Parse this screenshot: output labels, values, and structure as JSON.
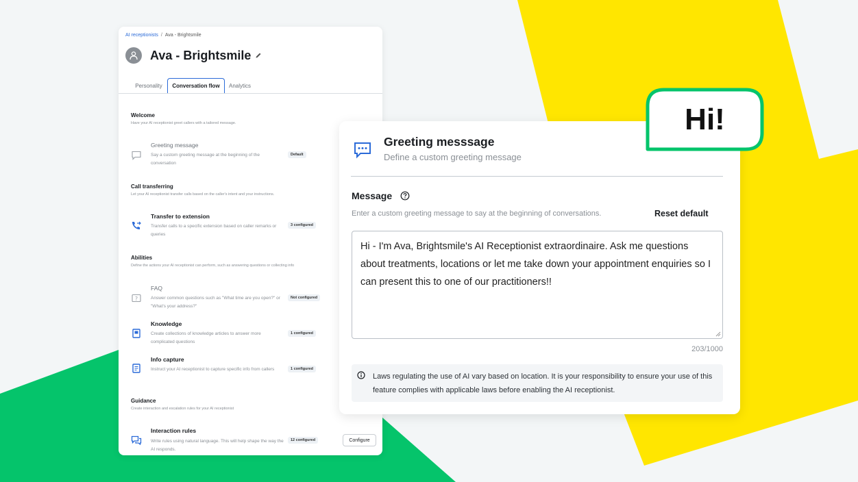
{
  "colors": {
    "background": "#f3f6f7",
    "yellow": "#ffe600",
    "green": "#05c46b",
    "accent_blue": "#2a6ad8"
  },
  "left_panel": {
    "breadcrumb": {
      "root": "AI receptionists",
      "separator": "/",
      "current": "Ava - Brightsmile"
    },
    "title": "Ava - Brightsmile",
    "tabs": [
      {
        "label": "Personality",
        "active": false
      },
      {
        "label": "Conversation flow",
        "active": true
      },
      {
        "label": "Analytics",
        "active": false
      }
    ],
    "sections": [
      {
        "title": "Welcome",
        "description": "Have your AI receptionist greet callers with a tailored message.",
        "items": [
          {
            "icon": "chat-bubble-icon",
            "title": "Greeting message",
            "description": "Say a custom greeting message at the beginning of the conversation",
            "badge": "Default"
          }
        ]
      },
      {
        "title": "Call transferring",
        "description": "Let your AI receptionist transfer calls based on the caller's intent and your instructions.",
        "items": [
          {
            "icon": "phone-forward-icon",
            "title": "Transfer to extension",
            "description": "Transfer calls to a specific extension based on caller remarks or queries",
            "badge": "3 configured"
          }
        ]
      },
      {
        "title": "Abilities",
        "description": "Define the actions your AI receptionist can perform, such as answering questions or collecting info",
        "items": [
          {
            "icon": "faq-icon",
            "title": "FAQ",
            "description": "Answer common questions such as \"What time are you open?\" or \"What's your address?\"",
            "badge": "Not configured"
          },
          {
            "icon": "book-icon",
            "title": "Knowledge",
            "description": "Create collections of knowledge articles to answer more complicated questions",
            "badge": "1 configured"
          },
          {
            "icon": "form-icon",
            "title": "Info capture",
            "description": "Instruct your AI receptionist to capture specific info from callers",
            "badge": "1 configured"
          }
        ]
      },
      {
        "title": "Guidance",
        "description": "Create interaction and escalation rules for your AI receptionist",
        "items": [
          {
            "icon": "chat-rules-icon",
            "title": "Interaction rules",
            "description": "Write rules using natural language. This will help shape the way the AI responds.",
            "badge": "12 configured",
            "action": "Configure"
          }
        ]
      }
    ]
  },
  "greeting_card": {
    "icon": "message-dots-icon",
    "title": "Greeting messsage",
    "subtitle": "Define a custom greeting message",
    "field_label": "Message",
    "hint": "Enter a custom greeting message to say at the beginning of conversations.",
    "reset_label": "Reset default",
    "message": "Hi - I'm Ava, Brightsmile's AI Receptionist extraordinaire. Ask me questions about treatments, locations or let me take down your appointment enquiries so I can present this to one of our practitioners!!",
    "counter": "203/1000",
    "notice": "Laws regulating the use of AI vary based on location. It is your responsibility to ensure your use of this feature complies with applicable laws before enabling the AI receptionist."
  },
  "speech_bubble": {
    "text": "Hi!"
  }
}
